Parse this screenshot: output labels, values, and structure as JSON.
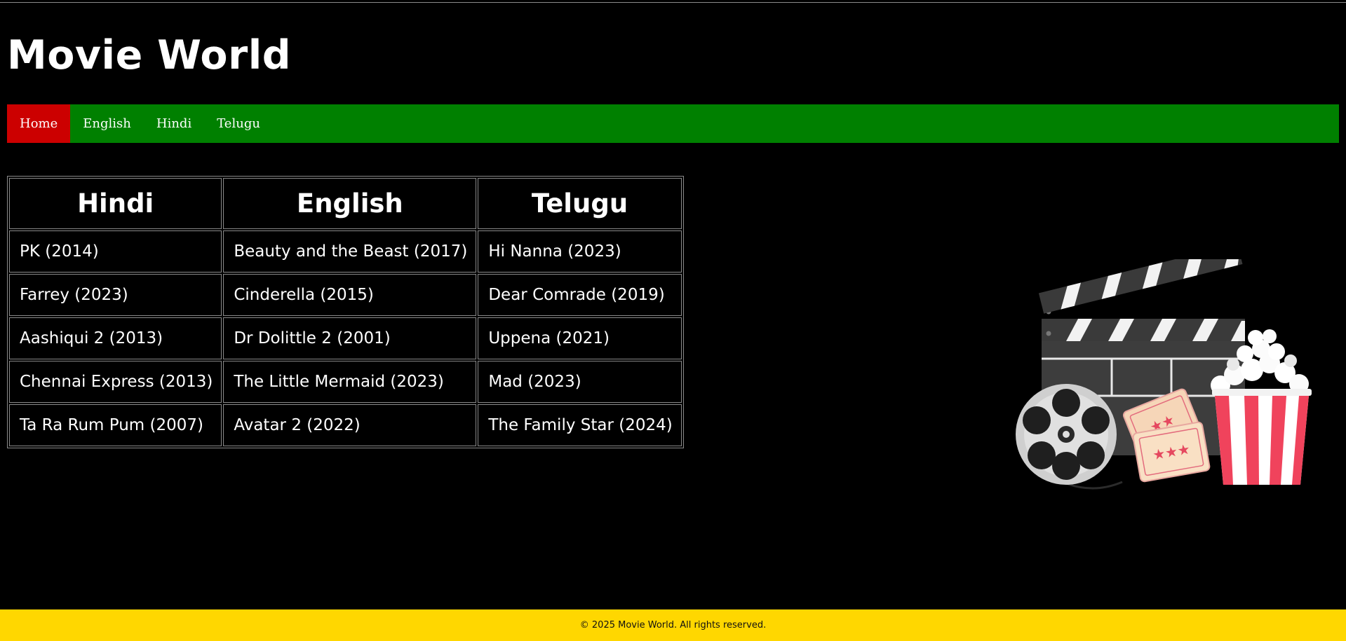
{
  "header": {
    "title": "Movie World"
  },
  "nav": {
    "items": [
      {
        "label": "Home",
        "active": true
      },
      {
        "label": "English",
        "active": false
      },
      {
        "label": "Hindi",
        "active": false
      },
      {
        "label": "Telugu",
        "active": false
      }
    ]
  },
  "table": {
    "headers": [
      "Hindi",
      "English",
      "Telugu"
    ],
    "rows": [
      [
        "PK (2014)",
        "Beauty and the Beast (2017)",
        "Hi Nanna (2023)"
      ],
      [
        "Farrey (2023)",
        "Cinderella (2015)",
        "Dear Comrade (2019)"
      ],
      [
        "Aashiqui 2 (2013)",
        "Dr Dolittle 2 (2001)",
        "Uppena (2021)"
      ],
      [
        "Chennai Express (2013)",
        "The Little Mermaid (2023)",
        "Mad (2023)"
      ],
      [
        "Ta Ra Rum Pum (2007)",
        "Avatar 2 (2022)",
        "The Family Star (2024)"
      ]
    ]
  },
  "illustration": {
    "icon": "cinema-clapperboard-popcorn-illustration"
  },
  "footer": {
    "text": "© 2025 Movie World. All rights reserved."
  },
  "colors": {
    "background": "#000000",
    "nav_bar": "#008000",
    "nav_active": "#cc0000",
    "footer": "#ffd700",
    "text": "#ffffff"
  }
}
